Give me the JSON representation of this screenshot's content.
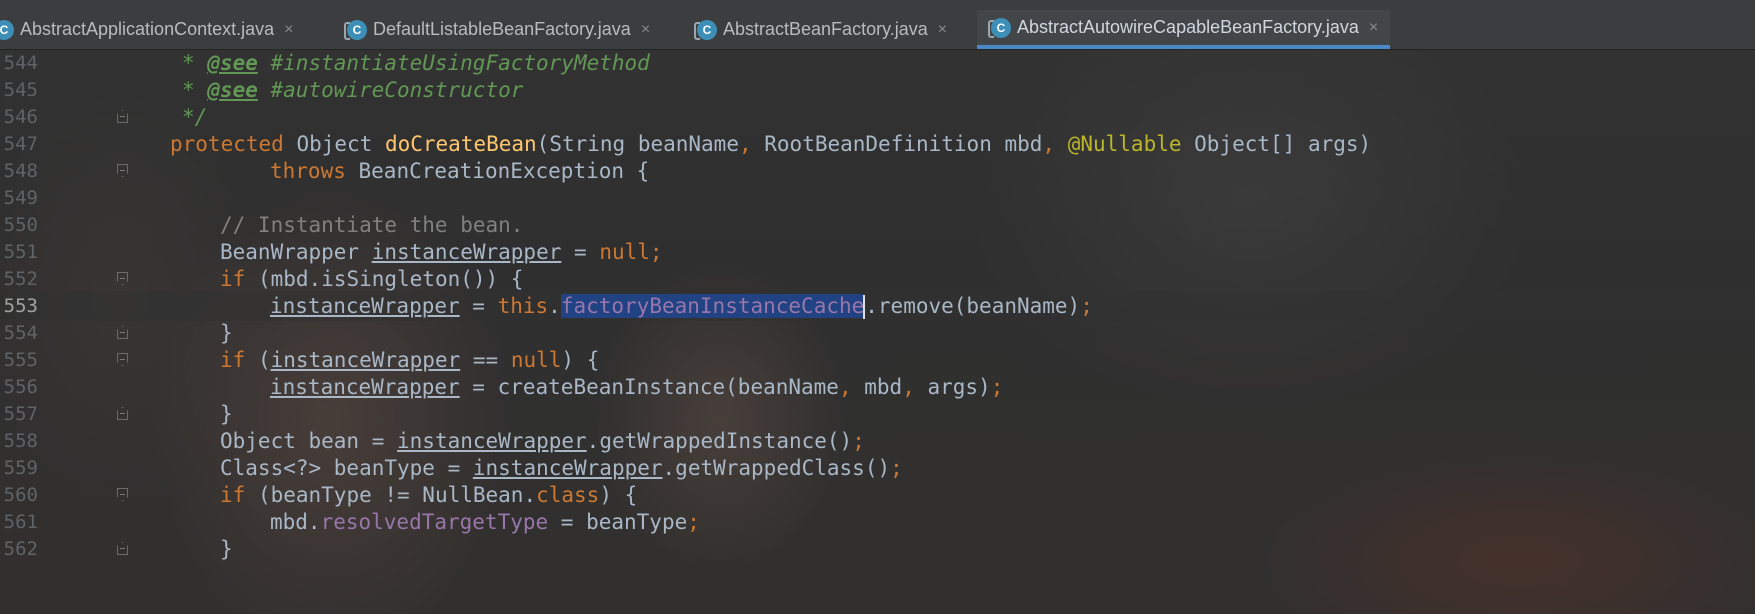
{
  "tabs": [
    {
      "label": "AbstractApplicationContext.java",
      "close": "×",
      "icon": "class-icon"
    },
    {
      "label": "DefaultListableBeanFactory.java",
      "close": "×",
      "icon": "class-icon"
    },
    {
      "label": "AbstractBeanFactory.java",
      "close": "×",
      "icon": "class-icon"
    },
    {
      "label": "AbstractAutowireCapableBeanFactory.java",
      "close": "×",
      "icon": "class-icon",
      "active": true
    }
  ],
  "tab_icon_letter": "C",
  "editor": {
    "current_line": "553",
    "lines": [
      {
        "num": "544",
        "parts": [
          [
            "doc",
            "* "
          ],
          [
            "doctag",
            "@see"
          ],
          [
            "doc",
            " #instantiateUsingFactoryMethod"
          ]
        ]
      },
      {
        "num": "545",
        "parts": [
          [
            "doc",
            "* "
          ],
          [
            "doctag",
            "@see"
          ],
          [
            "doc",
            " #autowireConstructor"
          ]
        ]
      },
      {
        "num": "546",
        "parts": [
          [
            "doc",
            "*/"
          ]
        ]
      },
      {
        "num": "547",
        "parts": [
          [
            "kw",
            "protected "
          ],
          [
            "",
            "Object "
          ],
          [
            "fn",
            "doCreateBean"
          ],
          [
            "",
            "(String beanName"
          ],
          [
            "kw",
            ", "
          ],
          [
            "",
            "RootBeanDefinition mbd"
          ],
          [
            "kw",
            ", "
          ],
          [
            "ann",
            "@Nullable "
          ],
          [
            "",
            "Object[] args)"
          ]
        ]
      },
      {
        "num": "548",
        "parts": [
          [
            "kw",
            "throws "
          ],
          [
            "",
            "BeanCreationException {"
          ]
        ]
      },
      {
        "num": "549",
        "parts": []
      },
      {
        "num": "550",
        "parts": [
          [
            "cm",
            "// Instantiate the bean."
          ]
        ]
      },
      {
        "num": "551",
        "parts": [
          [
            "",
            "BeanWrapper "
          ],
          [
            "und",
            "instanceWrapper"
          ],
          [
            "",
            " = "
          ],
          [
            "kw",
            "null;"
          ]
        ]
      },
      {
        "num": "552",
        "parts": [
          [
            "kw",
            "if "
          ],
          [
            "",
            "(mbd.isSingleton()) {"
          ]
        ]
      },
      {
        "num": "553",
        "parts": [
          [
            "und",
            "instanceWrapper"
          ],
          [
            "",
            " = "
          ],
          [
            "kw",
            "this"
          ],
          [
            "",
            "."
          ],
          [
            "sel",
            "factoryBeanInstanceCache"
          ],
          [
            "caret",
            ""
          ],
          [
            "",
            ".remove(beanName)"
          ],
          [
            "kw",
            ";"
          ]
        ]
      },
      {
        "num": "554",
        "parts": [
          [
            "",
            "}"
          ]
        ]
      },
      {
        "num": "555",
        "parts": [
          [
            "kw",
            "if "
          ],
          [
            "",
            "("
          ],
          [
            "und",
            "instanceWrapper"
          ],
          [
            "",
            " == "
          ],
          [
            "kw",
            "null"
          ],
          [
            "",
            ") {"
          ]
        ]
      },
      {
        "num": "556",
        "parts": [
          [
            "und",
            "instanceWrapper"
          ],
          [
            "",
            " = createBeanInstance(beanName"
          ],
          [
            "kw",
            ", "
          ],
          [
            "",
            "mbd"
          ],
          [
            "kw",
            ", "
          ],
          [
            "",
            "args)"
          ],
          [
            "kw",
            ";"
          ]
        ]
      },
      {
        "num": "557",
        "parts": [
          [
            "",
            "}"
          ]
        ]
      },
      {
        "num": "558",
        "parts": [
          [
            "",
            "Object bean = "
          ],
          [
            "und",
            "instanceWrapper"
          ],
          [
            "",
            ".getWrappedInstance()"
          ],
          [
            "kw",
            ";"
          ]
        ]
      },
      {
        "num": "559",
        "parts": [
          [
            "",
            "Class<?> beanType = "
          ],
          [
            "und",
            "instanceWrapper"
          ],
          [
            "",
            ".getWrappedClass()"
          ],
          [
            "kw",
            ";"
          ]
        ]
      },
      {
        "num": "560",
        "parts": [
          [
            "kw",
            "if "
          ],
          [
            "",
            "(beanType != NullBean."
          ],
          [
            "kw",
            "class"
          ],
          [
            "",
            ") {"
          ]
        ]
      },
      {
        "num": "561",
        "parts": [
          [
            "",
            "mbd."
          ],
          [
            "fld",
            "resolvedTargetType"
          ],
          [
            "",
            " = beanType"
          ],
          [
            "kw",
            ";"
          ]
        ]
      },
      {
        "num": "562",
        "parts": [
          [
            "",
            "}"
          ]
        ]
      }
    ]
  }
}
